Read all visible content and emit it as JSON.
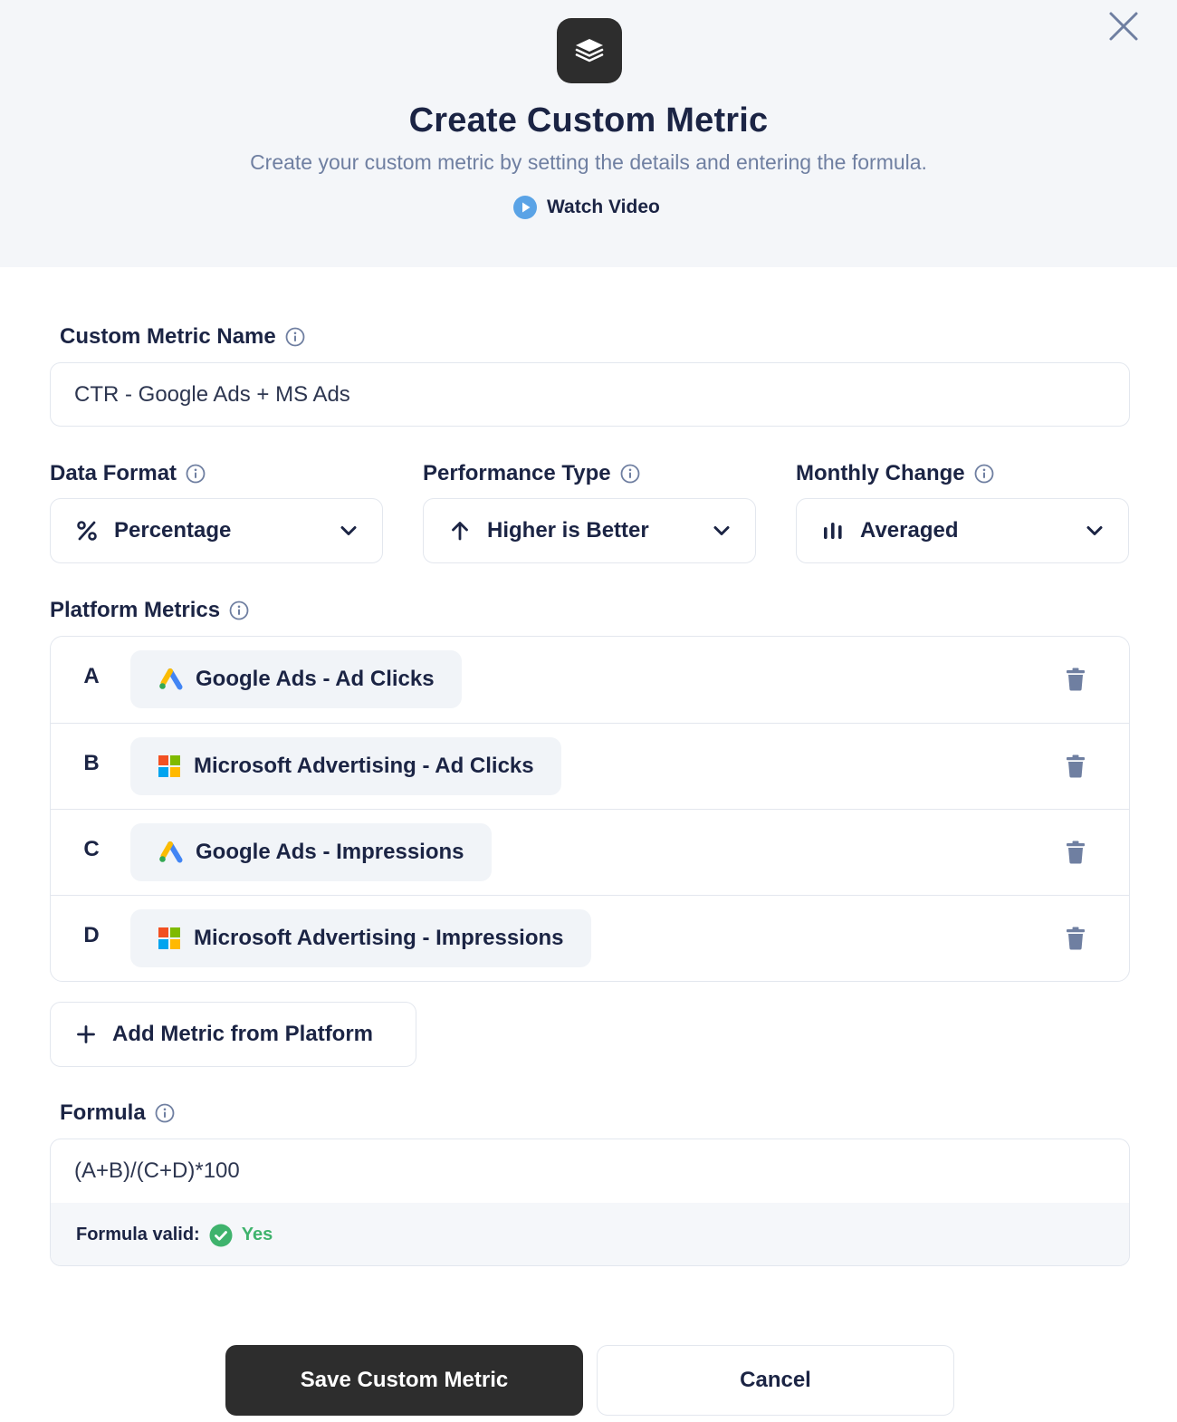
{
  "header": {
    "title": "Create Custom Metric",
    "subtitle": "Create your custom metric by setting the details and entering the formula.",
    "watch_video": "Watch Video"
  },
  "form": {
    "name_label": "Custom Metric Name",
    "name_value": "CTR - Google Ads + MS Ads",
    "data_format": {
      "label": "Data Format",
      "value": "Percentage"
    },
    "performance_type": {
      "label": "Performance Type",
      "value": "Higher is Better"
    },
    "monthly_change": {
      "label": "Monthly Change",
      "value": "Averaged"
    },
    "platform_metrics_label": "Platform Metrics",
    "metrics": [
      {
        "letter": "A",
        "platform": "google-ads",
        "label": "Google Ads - Ad Clicks"
      },
      {
        "letter": "B",
        "platform": "microsoft",
        "label": "Microsoft Advertising - Ad Clicks"
      },
      {
        "letter": "C",
        "platform": "google-ads",
        "label": "Google Ads - Impressions"
      },
      {
        "letter": "D",
        "platform": "microsoft",
        "label": "Microsoft Advertising - Impressions"
      }
    ],
    "add_metric": "Add Metric from Platform",
    "formula_label": "Formula",
    "formula_value": "(A+B)/(C+D)*100",
    "formula_valid_label": "Formula valid:",
    "formula_valid_value": "Yes"
  },
  "actions": {
    "save": "Save Custom Metric",
    "cancel": "Cancel"
  },
  "colors": {
    "primary_dark": "#2d2d2d",
    "heading": "#1b2444",
    "muted": "#6f7fa1",
    "valid_green": "#3fb36d",
    "play_blue": "#5aa3e6"
  }
}
